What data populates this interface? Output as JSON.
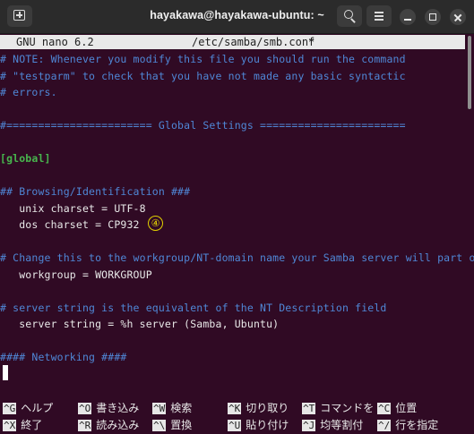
{
  "window": {
    "title": "hayakawa@hayakawa-ubuntu: ~"
  },
  "nano": {
    "version": "GNU nano 6.2",
    "filename": "/etc/samba/smb.conf",
    "modified_flag": "*"
  },
  "editor": {
    "lines": [
      {
        "text": "# NOTE: Whenever you modify this file you should run the command",
        "style": "comment"
      },
      {
        "text": "# \"testparm\" to check that you have not made any basic syntactic",
        "style": "comment"
      },
      {
        "text": "# errors.",
        "style": "comment"
      },
      {
        "text": "",
        "style": "plain"
      },
      {
        "text": "#======================= Global Settings =======================",
        "style": "comment"
      },
      {
        "text": "",
        "style": "plain"
      },
      {
        "text": "[global]",
        "style": "section"
      },
      {
        "text": "",
        "style": "plain"
      },
      {
        "text": "## Browsing/Identification ###",
        "style": "comment"
      },
      {
        "text": "   unix charset = UTF-8",
        "style": "plain"
      },
      {
        "text": "   dos charset = CP932",
        "style": "plain"
      },
      {
        "text": "",
        "style": "plain"
      },
      {
        "text": "# Change this to the workgroup/NT-domain name your Samba server will part of",
        "style": "comment"
      },
      {
        "text": "   workgroup = WORKGROUP",
        "style": "plain"
      },
      {
        "text": "",
        "style": "plain"
      },
      {
        "text": "# server string is the equivalent of the NT Description field",
        "style": "comment"
      },
      {
        "text": "   server string = %h server (Samba, Ubuntu)",
        "style": "plain"
      },
      {
        "text": "",
        "style": "plain"
      },
      {
        "text": "#### Networking ####",
        "style": "comment"
      }
    ],
    "annotation_marker": "④"
  },
  "shortcuts": [
    {
      "key": "^G",
      "label": "ヘルプ"
    },
    {
      "key": "^O",
      "label": "書き込み"
    },
    {
      "key": "^W",
      "label": "検索"
    },
    {
      "key": "^K",
      "label": "切り取り"
    },
    {
      "key": "^T",
      "label": "コマンドを"
    },
    {
      "key": "^C",
      "label": "位置"
    },
    {
      "key": "^X",
      "label": "終了"
    },
    {
      "key": "^R",
      "label": "読み込み"
    },
    {
      "key": "^\\",
      "label": "置換"
    },
    {
      "key": "^U",
      "label": "貼り付け"
    },
    {
      "key": "^J",
      "label": "均等割付"
    },
    {
      "key": "^/",
      "label": "行を指定"
    }
  ],
  "icons": {
    "new_tab": "new-tab-icon",
    "search": "search-icon",
    "menu": "hamburger-menu-icon",
    "minimize": "minimize-icon",
    "maximize": "maximize-icon",
    "close": "close-icon"
  },
  "colors": {
    "terminal_bg": "#300a24",
    "comment": "#4f87d6",
    "section": "#47b54d",
    "text": "#e8e8e8",
    "header_bar": "#e9e9e9"
  }
}
